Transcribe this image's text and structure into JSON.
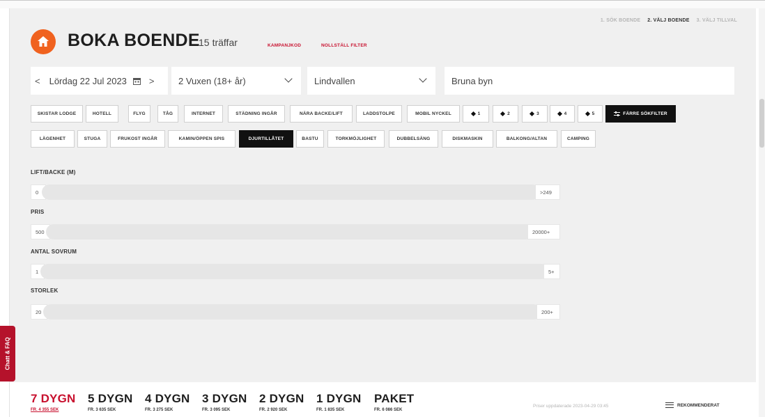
{
  "steps": [
    "1. SÖK BOENDE",
    "2. VÄLJ BOENDE",
    "3. VÄLJ TILLVAL"
  ],
  "header": {
    "title": "BOKA BOENDE",
    "hits_count": "15",
    "hits_label": "träffar",
    "campaign_link": "KAMPANJKOD",
    "reset_link": "NOLLSTÄLL FILTER"
  },
  "search": {
    "date": "Lördag 22 Jul 2023",
    "prev": "<",
    "next": ">",
    "guests": "2 Vuxen (18+ år)",
    "area": "Lindvallen",
    "location": "Bruna byn"
  },
  "filters": {
    "row1": [
      "SKISTAR LODGE",
      "HOTELL",
      "FLYG",
      "TÅG",
      "INTERNET",
      "STÄDNING INGÅR",
      "NÄRA BACKE/LIFT",
      "LADDSTOLPE",
      "MOBIL NYCKEL",
      "1",
      "2",
      "3",
      "4",
      "5",
      "FÄRRE SÖKFILTER"
    ],
    "row2": [
      "LÄGENHET",
      "STUGA",
      "FRUKOST INGÅR",
      "KAMIN/ÖPPEN SPIS",
      "DJURTILLÅTET",
      "BASTU",
      "TORKMÖJLIGHET",
      "DUBBELSÄNG",
      "DISKMASKIN",
      "BALKONG/ALTAN",
      "CAMPING"
    ]
  },
  "sliders": [
    {
      "label": "LIFT/BACKE (M)",
      "min": "0",
      "max": ">249"
    },
    {
      "label": "PRIS",
      "min": "500",
      "max": "20000+"
    },
    {
      "label": "ANTAL SOVRUM",
      "min": "1",
      "max": "5+"
    },
    {
      "label": "STORLEK",
      "min": "20",
      "max": "200+"
    }
  ],
  "chat": "Chatt & FAQ",
  "durations": [
    {
      "label": "7 DYGN",
      "price": "FR. 4 355 SEK"
    },
    {
      "label": "5 DYGN",
      "price": "FR. 3 635 SEK"
    },
    {
      "label": "4 DYGN",
      "price": "FR. 3 275 SEK"
    },
    {
      "label": "3 DYGN",
      "price": "FR. 3 095 SEK"
    },
    {
      "label": "2 DYGN",
      "price": "FR. 2 920 SEK"
    },
    {
      "label": "1 DYGN",
      "price": "FR. 1 835 SEK"
    },
    {
      "label": "PAKET",
      "price": "FR. 6 086 SEK"
    }
  ],
  "footer": {
    "updated": "Priser uppdaterade 2023-04-29 03:45",
    "sort": "REKOMMENDERAT"
  },
  "colors": {
    "accent": "#c8102e",
    "logo": "#f0621f",
    "dark": "#111111"
  },
  "icons": {
    "logo": "home-icon",
    "date_picker": "calendar-icon",
    "dropdown": "chevron-down-icon",
    "sort": "sort-lines-icon",
    "filter_toggle": "sliders-icon"
  }
}
